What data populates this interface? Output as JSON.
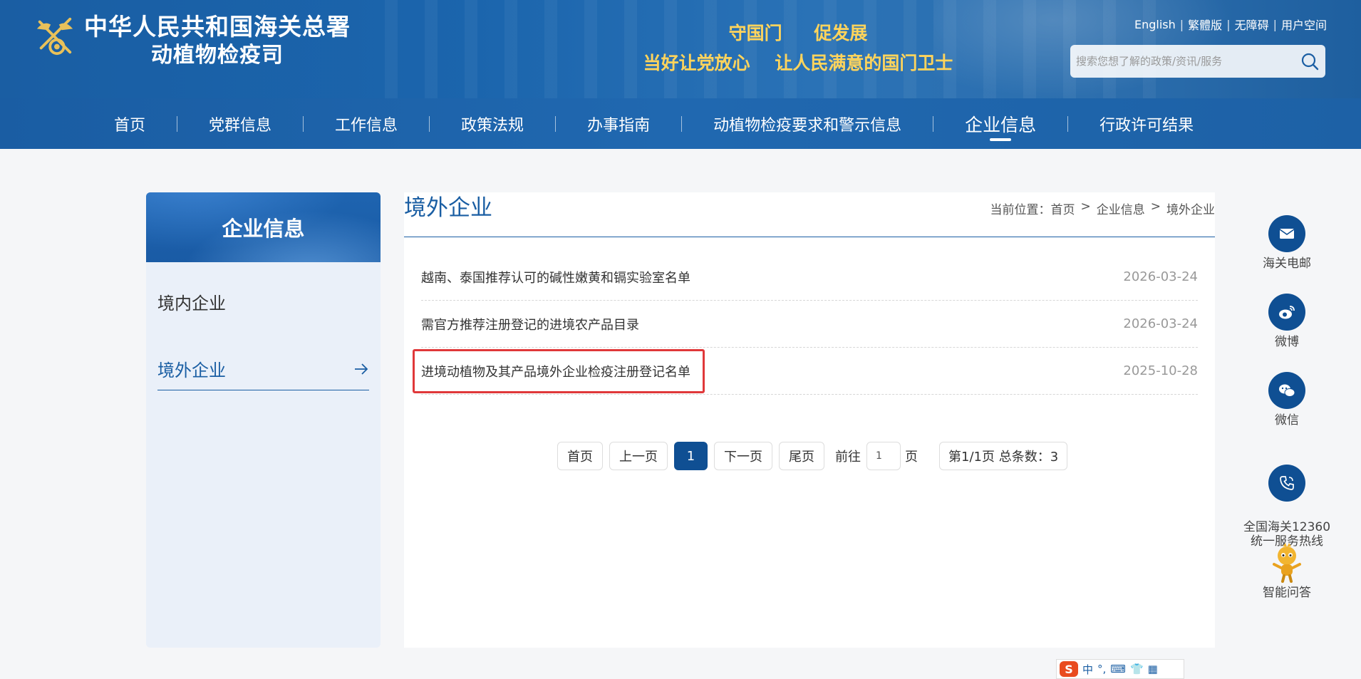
{
  "header": {
    "org_line1": "中华人民共和国海关总署",
    "org_line2": "动植物检疫司",
    "slogan_a": "守国门",
    "slogan_b": "促发展",
    "slogan_c": "当好让党放心",
    "slogan_d": "让人民满意的国门卫士",
    "links": [
      "English",
      "繁體版",
      "无障碍",
      "用户空间"
    ],
    "search_placeholder": "搜索您想了解的政策/资讯/服务"
  },
  "nav": {
    "items": [
      "首页",
      "党群信息",
      "工作信息",
      "政策法规",
      "办事指南",
      "动植物检疫要求和警示信息",
      "企业信息",
      "行政许可结果"
    ],
    "active": "企业信息"
  },
  "sidebar": {
    "title": "企业信息",
    "items": [
      "境内企业",
      "境外企业"
    ],
    "active": "境外企业"
  },
  "main": {
    "title": "境外企业",
    "breadcrumb": {
      "prefix": "当前位置：",
      "items": [
        "首页",
        "企业信息",
        "境外企业"
      ],
      "sep": ">"
    },
    "rows": [
      {
        "title": "越南、泰国推荐认可的碱性嫩黄和镉实验室名单",
        "date": "2026-03-24"
      },
      {
        "title": "需官方推荐注册登记的进境农产品目录",
        "date": "2026-03-24"
      },
      {
        "title": "进境动植物及其产品境外企业检疫注册登记名单",
        "date": "2025-10-28"
      }
    ]
  },
  "pager": {
    "first": "首页",
    "prev": "上一页",
    "current": "1",
    "next": "下一页",
    "last": "尾页",
    "goto_label": "前往",
    "goto_value": "1",
    "page_label": "页",
    "info": "第1/1页 总条数：3"
  },
  "float": {
    "items": [
      "海关电邮",
      "微博",
      "微信",
      "全国海关12360\n统一服务热线",
      "智能问答"
    ]
  },
  "ime": {
    "logo": "S",
    "lang": "中"
  },
  "colors": {
    "brand_blue": "#1a5ea3",
    "active_page": "#0f4f93",
    "highlight_red": "#e0383a",
    "slogan_gold": "#ffd45c"
  }
}
